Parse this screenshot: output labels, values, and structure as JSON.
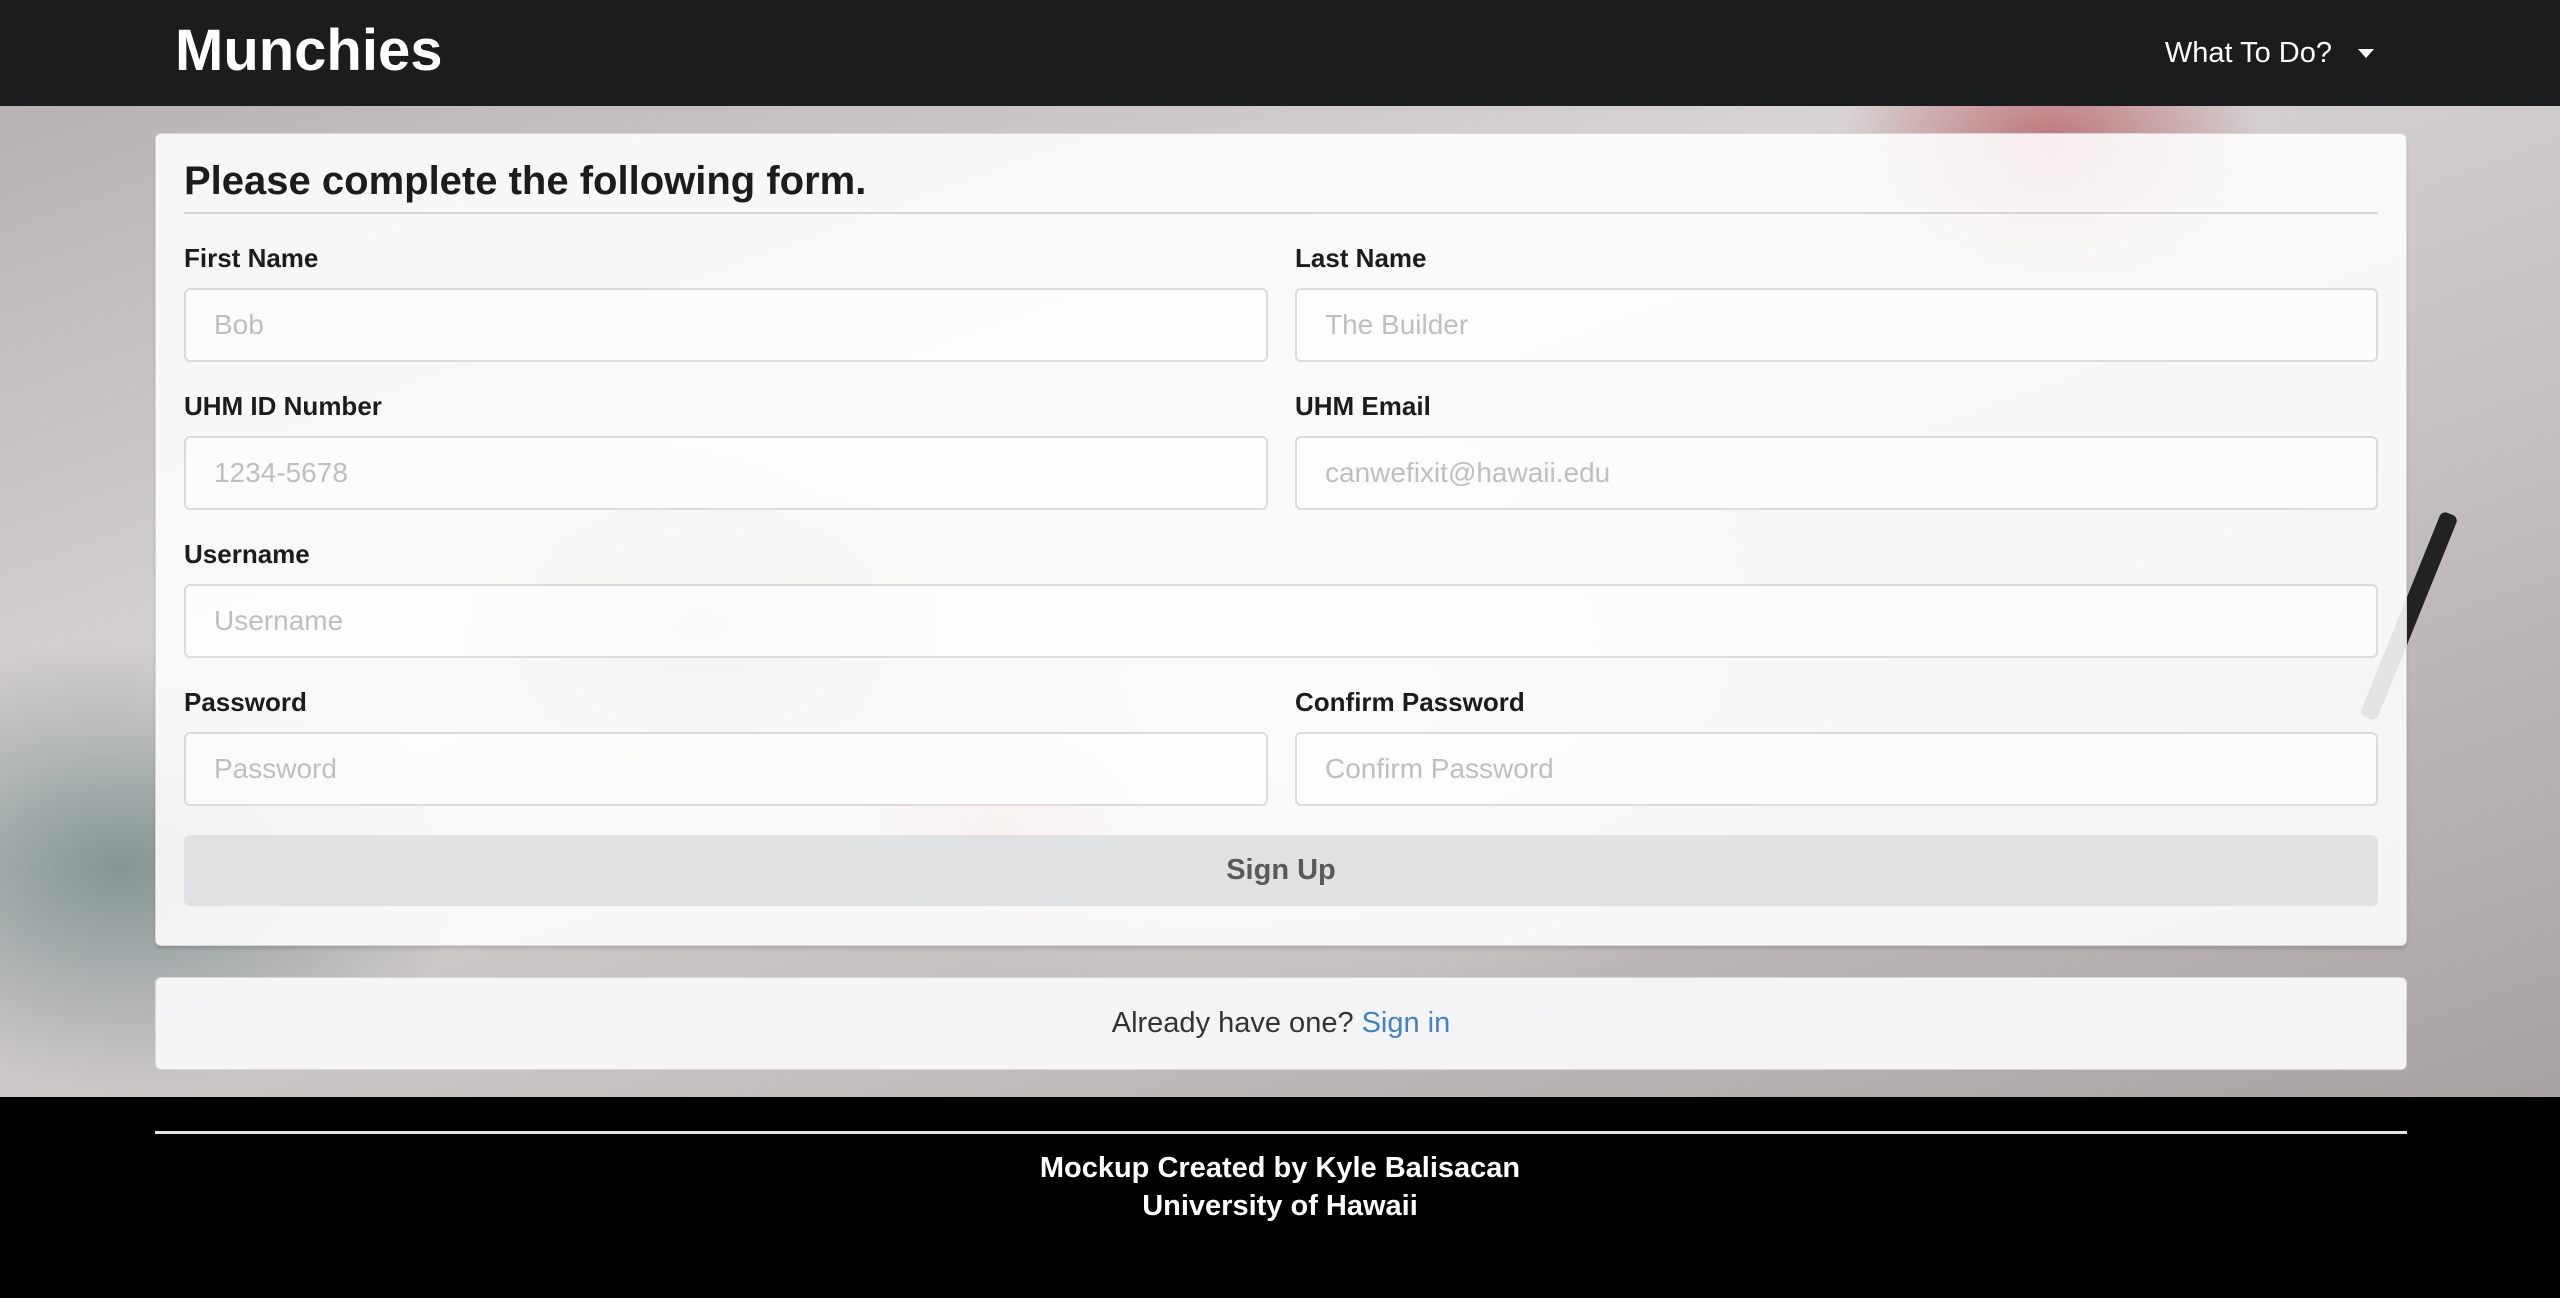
{
  "navbar": {
    "brand": "Munchies",
    "menu_label": "What To Do?"
  },
  "form": {
    "title": "Please complete the following form.",
    "first_name": {
      "label": "First Name",
      "placeholder": "Bob",
      "value": ""
    },
    "last_name": {
      "label": "Last Name",
      "placeholder": "The Builder",
      "value": ""
    },
    "uhm_id": {
      "label": "UHM ID Number",
      "placeholder": "1234-5678",
      "value": ""
    },
    "uhm_email": {
      "label": "UHM Email",
      "placeholder": "canwefixit@hawaii.edu",
      "value": ""
    },
    "username": {
      "label": "Username",
      "placeholder": "Username",
      "value": ""
    },
    "password": {
      "label": "Password",
      "placeholder": "Password",
      "value": ""
    },
    "confirm_password": {
      "label": "Confirm Password",
      "placeholder": "Confirm Password",
      "value": ""
    },
    "submit_label": "Sign Up"
  },
  "signin": {
    "prompt": "Already have one?",
    "link_label": "Sign in"
  },
  "footer": {
    "line1": "Mockup Created by Kyle Balisacan",
    "line2": "University of Hawaii"
  },
  "colors": {
    "navbar_bg": "#1b1c1d",
    "link": "#4183c4",
    "button_bg": "#e0e1e2",
    "footer_bg": "#000000"
  }
}
